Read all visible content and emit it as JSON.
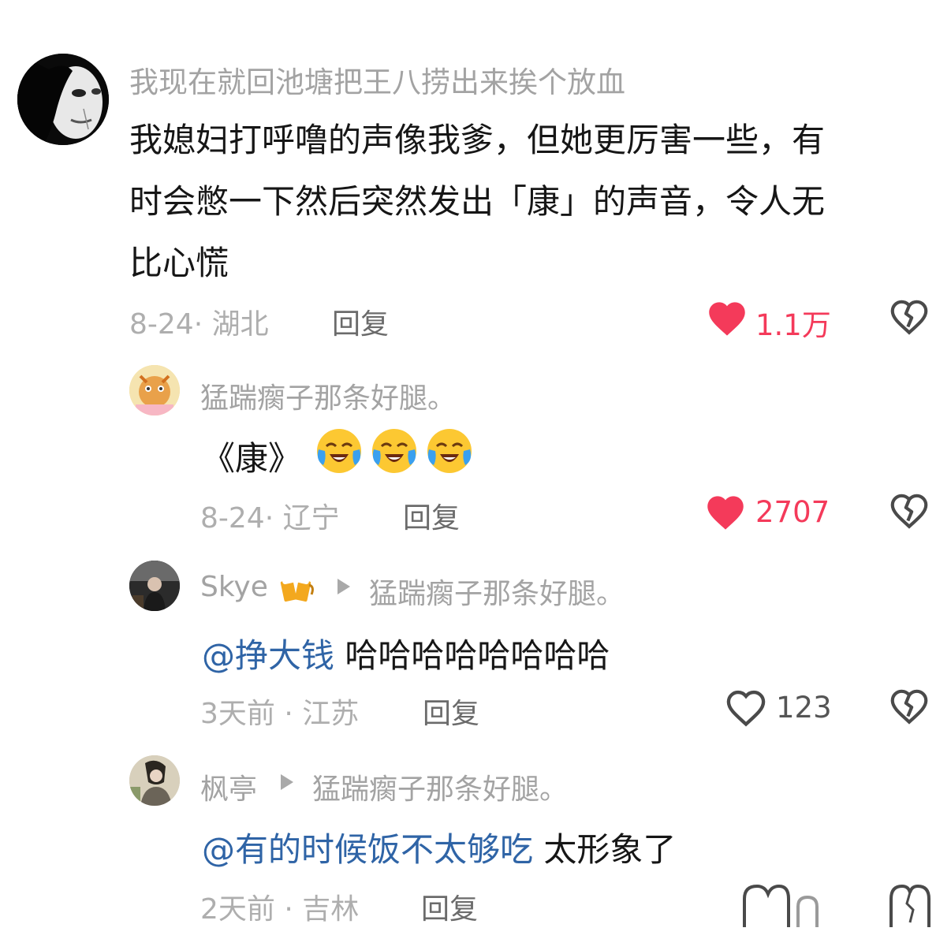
{
  "colors": {
    "like_active": "#f43a5a",
    "mention": "#2f64a6",
    "secondary": "#a3a3a3"
  },
  "comments": [
    {
      "username": "我现在就回池塘把王八捞出来挨个放血",
      "text_lines": [
        "我媳妇打呼噜的声像我爹，但她更厉害一些，有",
        "时会憋一下然后突然发出「康」的声音，令人无",
        "比心慌"
      ],
      "date_location": "8-24· 湖北",
      "reply_label": "回复",
      "likes": "1.1万",
      "liked": true
    },
    {
      "username": "猛踹瘸子那条好腿。",
      "text": "《康》",
      "emojis": [
        "crying-laughing-emoji",
        "crying-laughing-emoji",
        "crying-laughing-emoji"
      ],
      "date_location": "8-24· 辽宁",
      "reply_label": "回复",
      "likes": "2707",
      "liked": true
    },
    {
      "username": "Skye",
      "username_emoji": "beer-mugs-emoji",
      "reply_to": "猛踹瘸子那条好腿。",
      "mention": "@挣大钱",
      "text": " 哈哈哈哈哈哈哈哈",
      "date_location": "3天前 · 江苏",
      "reply_label": "回复",
      "likes": "123",
      "liked": false
    },
    {
      "username": "枫亭",
      "reply_to": "猛踹瘸子那条好腿。",
      "mention": "@有的时候饭不太够吃",
      "text": " 太形象了",
      "date_location": "2天前 · 吉林",
      "reply_label": "回复",
      "likes": "",
      "liked": false
    }
  ],
  "icons": [
    "heart-icon",
    "dislike-broken-heart-icon",
    "reply-arrow-icon"
  ]
}
